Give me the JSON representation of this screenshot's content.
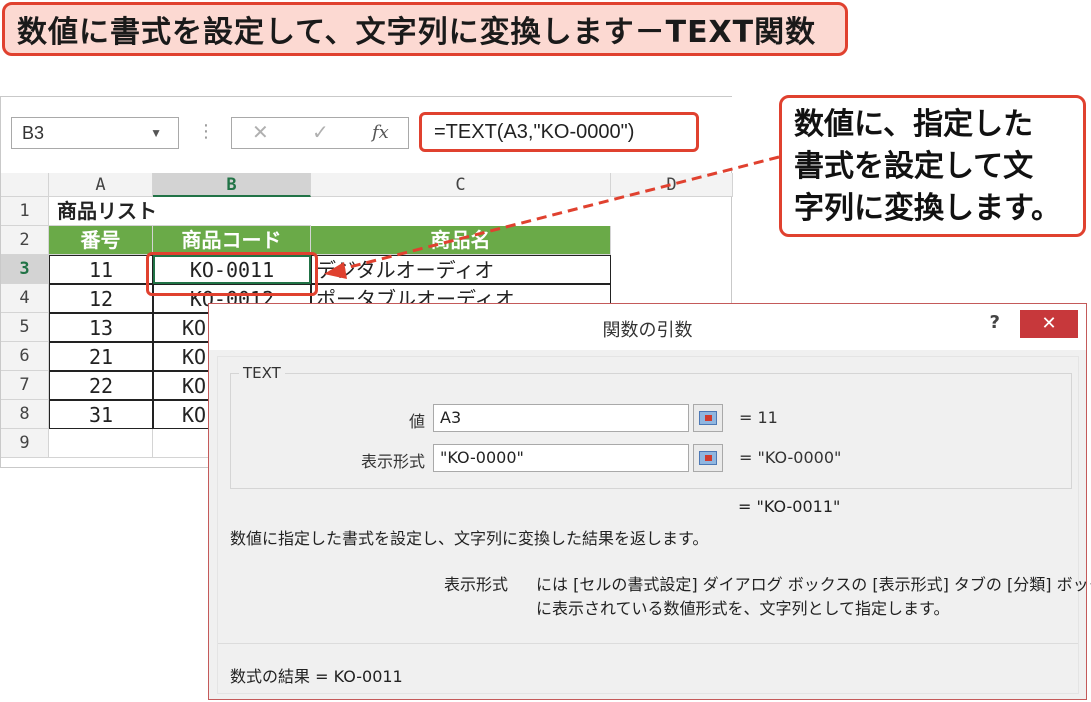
{
  "banner": {
    "title": "数値に書式を設定して、文字列に変換します－TEXT関数"
  },
  "excel": {
    "name_box": "B3",
    "formula": "=TEXT(A3,\"KO-0000\")",
    "fx_label": "fx",
    "cancel_glyph": "✕",
    "enter_glyph": "✓",
    "sep_glyph": "⋮",
    "dropdown_glyph": "▼",
    "columns": [
      "A",
      "B",
      "C",
      "D"
    ],
    "rows": [
      "1",
      "2",
      "3",
      "4",
      "5",
      "6",
      "7",
      "8",
      "9"
    ],
    "cells": {
      "a1": "商品リスト",
      "a2": "番号",
      "b2": "商品コード",
      "c2": "商品名",
      "a3": "11",
      "b3": "KO-0011",
      "c3": "デジタルオーディオ",
      "a4": "12",
      "b4": "KO-0012",
      "c4": "ポータブルオーディオ",
      "a5": "13",
      "b5": "KO",
      "a6": "21",
      "b6": "KO",
      "a7": "22",
      "b7": "KO",
      "a8": "31",
      "b8": "KO"
    }
  },
  "callout": {
    "line1": "数値に、指定した",
    "line2": "書式を設定して文",
    "line3": "字列に変換します。"
  },
  "dialog": {
    "title": "関数の引数",
    "help": "?",
    "close": "✕",
    "function_name": "TEXT",
    "args": [
      {
        "label": "値",
        "value": "A3",
        "result": "=  11"
      },
      {
        "label": "表示形式",
        "value": "\"KO-0000\"",
        "result": "=  \"KO-0000\""
      }
    ],
    "overall_result": "=  \"KO-0011\"",
    "description": "数値に指定した書式を設定し、文字列に変換した結果を返します。",
    "arg_help_name": "表示形式",
    "arg_help_line1": "には [セルの書式設定] ダイアログ ボックスの [表示形式] タブの [分類] ボックス",
    "arg_help_line2": "に表示されている数値形式を、文字列として指定します。",
    "formula_result": "数式の結果 =   KO-0011"
  },
  "colors": {
    "accent_red": "#e0412f",
    "header_green": "#6aaa48",
    "excel_green": "#217346",
    "close_red": "#c7383b"
  }
}
